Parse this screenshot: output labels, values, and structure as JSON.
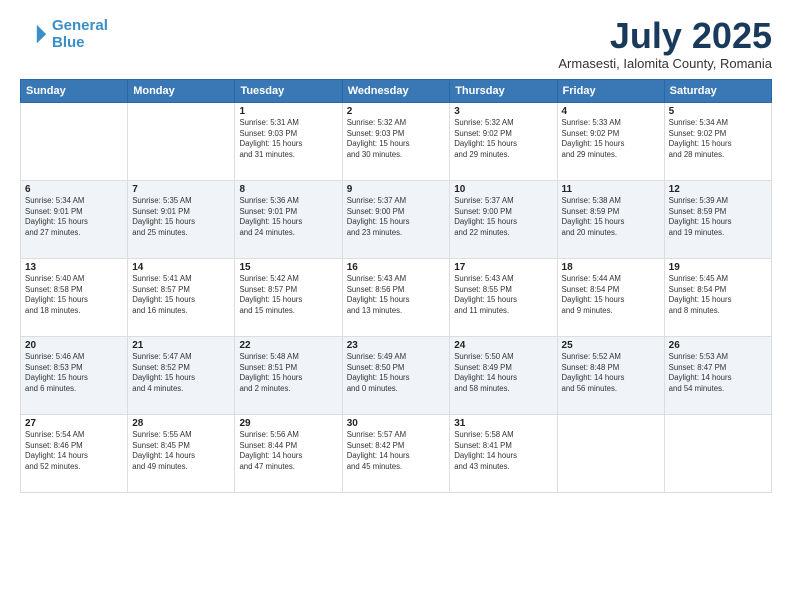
{
  "logo": {
    "line1": "General",
    "line2": "Blue"
  },
  "title": "July 2025",
  "subtitle": "Armasesti, Ialomita County, Romania",
  "days_of_week": [
    "Sunday",
    "Monday",
    "Tuesday",
    "Wednesday",
    "Thursday",
    "Friday",
    "Saturday"
  ],
  "weeks": [
    [
      {
        "day": "",
        "info": ""
      },
      {
        "day": "",
        "info": ""
      },
      {
        "day": "1",
        "info": "Sunrise: 5:31 AM\nSunset: 9:03 PM\nDaylight: 15 hours\nand 31 minutes."
      },
      {
        "day": "2",
        "info": "Sunrise: 5:32 AM\nSunset: 9:03 PM\nDaylight: 15 hours\nand 30 minutes."
      },
      {
        "day": "3",
        "info": "Sunrise: 5:32 AM\nSunset: 9:02 PM\nDaylight: 15 hours\nand 29 minutes."
      },
      {
        "day": "4",
        "info": "Sunrise: 5:33 AM\nSunset: 9:02 PM\nDaylight: 15 hours\nand 29 minutes."
      },
      {
        "day": "5",
        "info": "Sunrise: 5:34 AM\nSunset: 9:02 PM\nDaylight: 15 hours\nand 28 minutes."
      }
    ],
    [
      {
        "day": "6",
        "info": "Sunrise: 5:34 AM\nSunset: 9:01 PM\nDaylight: 15 hours\nand 27 minutes."
      },
      {
        "day": "7",
        "info": "Sunrise: 5:35 AM\nSunset: 9:01 PM\nDaylight: 15 hours\nand 25 minutes."
      },
      {
        "day": "8",
        "info": "Sunrise: 5:36 AM\nSunset: 9:01 PM\nDaylight: 15 hours\nand 24 minutes."
      },
      {
        "day": "9",
        "info": "Sunrise: 5:37 AM\nSunset: 9:00 PM\nDaylight: 15 hours\nand 23 minutes."
      },
      {
        "day": "10",
        "info": "Sunrise: 5:37 AM\nSunset: 9:00 PM\nDaylight: 15 hours\nand 22 minutes."
      },
      {
        "day": "11",
        "info": "Sunrise: 5:38 AM\nSunset: 8:59 PM\nDaylight: 15 hours\nand 20 minutes."
      },
      {
        "day": "12",
        "info": "Sunrise: 5:39 AM\nSunset: 8:59 PM\nDaylight: 15 hours\nand 19 minutes."
      }
    ],
    [
      {
        "day": "13",
        "info": "Sunrise: 5:40 AM\nSunset: 8:58 PM\nDaylight: 15 hours\nand 18 minutes."
      },
      {
        "day": "14",
        "info": "Sunrise: 5:41 AM\nSunset: 8:57 PM\nDaylight: 15 hours\nand 16 minutes."
      },
      {
        "day": "15",
        "info": "Sunrise: 5:42 AM\nSunset: 8:57 PM\nDaylight: 15 hours\nand 15 minutes."
      },
      {
        "day": "16",
        "info": "Sunrise: 5:43 AM\nSunset: 8:56 PM\nDaylight: 15 hours\nand 13 minutes."
      },
      {
        "day": "17",
        "info": "Sunrise: 5:43 AM\nSunset: 8:55 PM\nDaylight: 15 hours\nand 11 minutes."
      },
      {
        "day": "18",
        "info": "Sunrise: 5:44 AM\nSunset: 8:54 PM\nDaylight: 15 hours\nand 9 minutes."
      },
      {
        "day": "19",
        "info": "Sunrise: 5:45 AM\nSunset: 8:54 PM\nDaylight: 15 hours\nand 8 minutes."
      }
    ],
    [
      {
        "day": "20",
        "info": "Sunrise: 5:46 AM\nSunset: 8:53 PM\nDaylight: 15 hours\nand 6 minutes."
      },
      {
        "day": "21",
        "info": "Sunrise: 5:47 AM\nSunset: 8:52 PM\nDaylight: 15 hours\nand 4 minutes."
      },
      {
        "day": "22",
        "info": "Sunrise: 5:48 AM\nSunset: 8:51 PM\nDaylight: 15 hours\nand 2 minutes."
      },
      {
        "day": "23",
        "info": "Sunrise: 5:49 AM\nSunset: 8:50 PM\nDaylight: 15 hours\nand 0 minutes."
      },
      {
        "day": "24",
        "info": "Sunrise: 5:50 AM\nSunset: 8:49 PM\nDaylight: 14 hours\nand 58 minutes."
      },
      {
        "day": "25",
        "info": "Sunrise: 5:52 AM\nSunset: 8:48 PM\nDaylight: 14 hours\nand 56 minutes."
      },
      {
        "day": "26",
        "info": "Sunrise: 5:53 AM\nSunset: 8:47 PM\nDaylight: 14 hours\nand 54 minutes."
      }
    ],
    [
      {
        "day": "27",
        "info": "Sunrise: 5:54 AM\nSunset: 8:46 PM\nDaylight: 14 hours\nand 52 minutes."
      },
      {
        "day": "28",
        "info": "Sunrise: 5:55 AM\nSunset: 8:45 PM\nDaylight: 14 hours\nand 49 minutes."
      },
      {
        "day": "29",
        "info": "Sunrise: 5:56 AM\nSunset: 8:44 PM\nDaylight: 14 hours\nand 47 minutes."
      },
      {
        "day": "30",
        "info": "Sunrise: 5:57 AM\nSunset: 8:42 PM\nDaylight: 14 hours\nand 45 minutes."
      },
      {
        "day": "31",
        "info": "Sunrise: 5:58 AM\nSunset: 8:41 PM\nDaylight: 14 hours\nand 43 minutes."
      },
      {
        "day": "",
        "info": ""
      },
      {
        "day": "",
        "info": ""
      }
    ]
  ]
}
